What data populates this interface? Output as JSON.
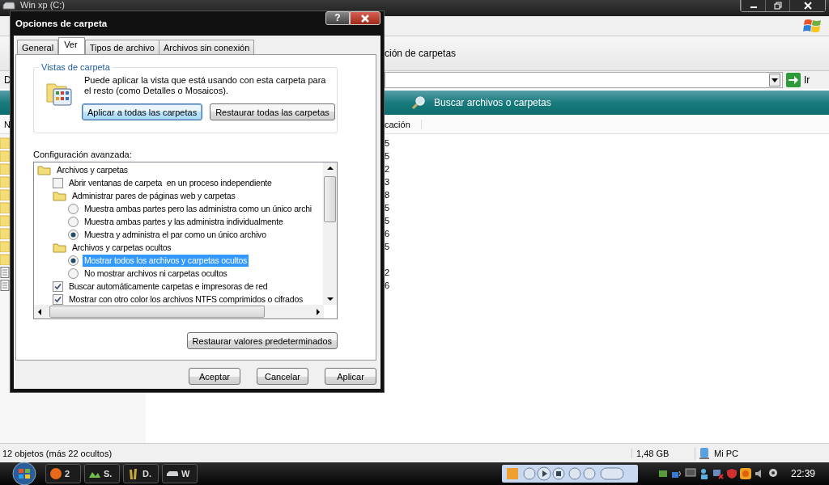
{
  "explorer": {
    "title": "Win xp (C:)",
    "toolbar_text": "ción de carpetas",
    "address_label": "D",
    "go_button": "Ir",
    "search_bar": "Buscar archivos o carpetas",
    "columns": [
      "N",
      "cación"
    ],
    "rows": [
      {
        "kind": "folder",
        "column_2": "5"
      },
      {
        "kind": "folder",
        "column_2": "5"
      },
      {
        "kind": "folder",
        "column_2": "2"
      },
      {
        "kind": "folder",
        "column_2": "3"
      },
      {
        "kind": "folder",
        "column_2": "8"
      },
      {
        "kind": "folder",
        "column_2": "5"
      },
      {
        "kind": "folder",
        "column_2": "5"
      },
      {
        "kind": "folder",
        "column_2": "6"
      },
      {
        "kind": "folder",
        "column_2": "5"
      },
      {
        "kind": "folder"
      },
      {
        "kind": "file",
        "column_2": "2"
      },
      {
        "kind": "file",
        "column_2": "6"
      }
    ],
    "status_bar": {
      "objects": "12 objetos (más 22 ocultos)",
      "size": "1,48 GB",
      "location": "Mi PC"
    }
  },
  "dialog": {
    "title": "Opciones de carpeta",
    "help_button": "?",
    "tabs": [
      {
        "label": "General",
        "selected": false
      },
      {
        "label": "Ver",
        "selected": true
      },
      {
        "label": "Tipos de archivo",
        "selected": false
      },
      {
        "label": "Archivos sin conexión",
        "selected": false
      }
    ],
    "folder_views": {
      "title": "Vistas de carpeta",
      "text": "Puede aplicar la vista que está usando con esta carpeta para el resto (como Detalles o Mosaicos).",
      "buttons": [
        {
          "label": "Aplicar a todas las carpetas",
          "default": true
        },
        {
          "label": "Restaurar todas las carpetas",
          "default": false
        }
      ]
    },
    "advanced": {
      "label": "Configuración avanzada:",
      "items": [
        {
          "kind": "folder",
          "label": "Archivos y carpetas",
          "selected": false,
          "children": [
            {
              "kind": "checkbox",
              "label": "Abrir ventanas de carpeta  en un proceso independiente",
              "checked": false,
              "selected": false
            },
            {
              "kind": "folder",
              "label": "Administrar pares de páginas web y carpetas",
              "selected": false,
              "children": [
                {
                  "kind": "radio",
                  "label": "Muestra ambas partes pero las administra como un único archi",
                  "checked": false,
                  "selected": false
                },
                {
                  "kind": "radio",
                  "label": "Muestra ambas partes y las administra individualmente",
                  "checked": false,
                  "selected": false
                },
                {
                  "kind": "radio",
                  "label": "Muestra y administra el par como un único archivo",
                  "checked": true,
                  "selected": false
                }
              ]
            },
            {
              "kind": "folder",
              "label": "Archivos y carpetas ocultos",
              "selected": false,
              "children": [
                {
                  "kind": "radio",
                  "label": "Mostrar todos los archivos y carpetas ocultos",
                  "checked": true,
                  "selected": true
                },
                {
                  "kind": "radio",
                  "label": "No mostrar archivos ni carpetas ocultos",
                  "checked": false,
                  "selected": false
                }
              ]
            },
            {
              "kind": "checkbox",
              "label": "Buscar automáticamente carpetas e impresoras de red",
              "checked": true,
              "selected": false
            },
            {
              "kind": "checkbox",
              "label": "Mostrar con otro color los archivos NTFS comprimidos o cifrados",
              "checked": true,
              "selected": false
            }
          ]
        }
      ],
      "restore_button": "Restaurar valores predeterminados"
    },
    "buttons": [
      "Aceptar",
      "Cancelar",
      "Aplicar"
    ]
  },
  "taskbar": {
    "buttons": [
      {
        "kind": "firefox",
        "label": "2"
      },
      {
        "kind": "network",
        "label": "S."
      },
      {
        "kind": "brushes",
        "label": "D."
      },
      {
        "kind": "drive",
        "label": "W"
      }
    ],
    "clock": "22:39"
  }
}
